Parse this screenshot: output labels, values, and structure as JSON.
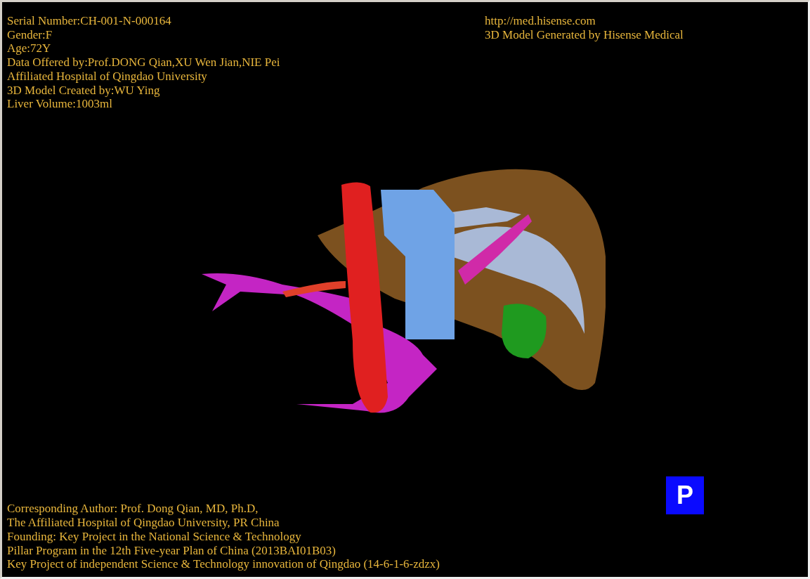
{
  "patient_info": [
    "Serial Number:CH-001-N-000164",
    "Gender:F",
    "Age:72Y",
    "Data Offered by:Prof.DONG Qian,XU Wen Jian,NIE Pei",
    "Affiliated Hospital of Qingdao University",
    "3D Model Created by:WU Ying",
    "Liver Volume:1003ml"
  ],
  "vendor_info": [
    "http://med.hisense.com",
    "3D Model Generated by Hisense Medical"
  ],
  "projection_button": {
    "label": "P"
  },
  "credits": [
    "Corresponding Author: Prof. Dong Qian, MD, Ph.D,",
    "The Affiliated Hospital of Qingdao University, PR China",
    "Founding: Key Project in the National Science & Technology",
    "Pillar Program in the 12th Five-year Plan of China (2013BAI01B03)",
    "Key Project of independent Science & Technology innovation of Qingdao (14-6-1-6-zdzx)"
  ]
}
